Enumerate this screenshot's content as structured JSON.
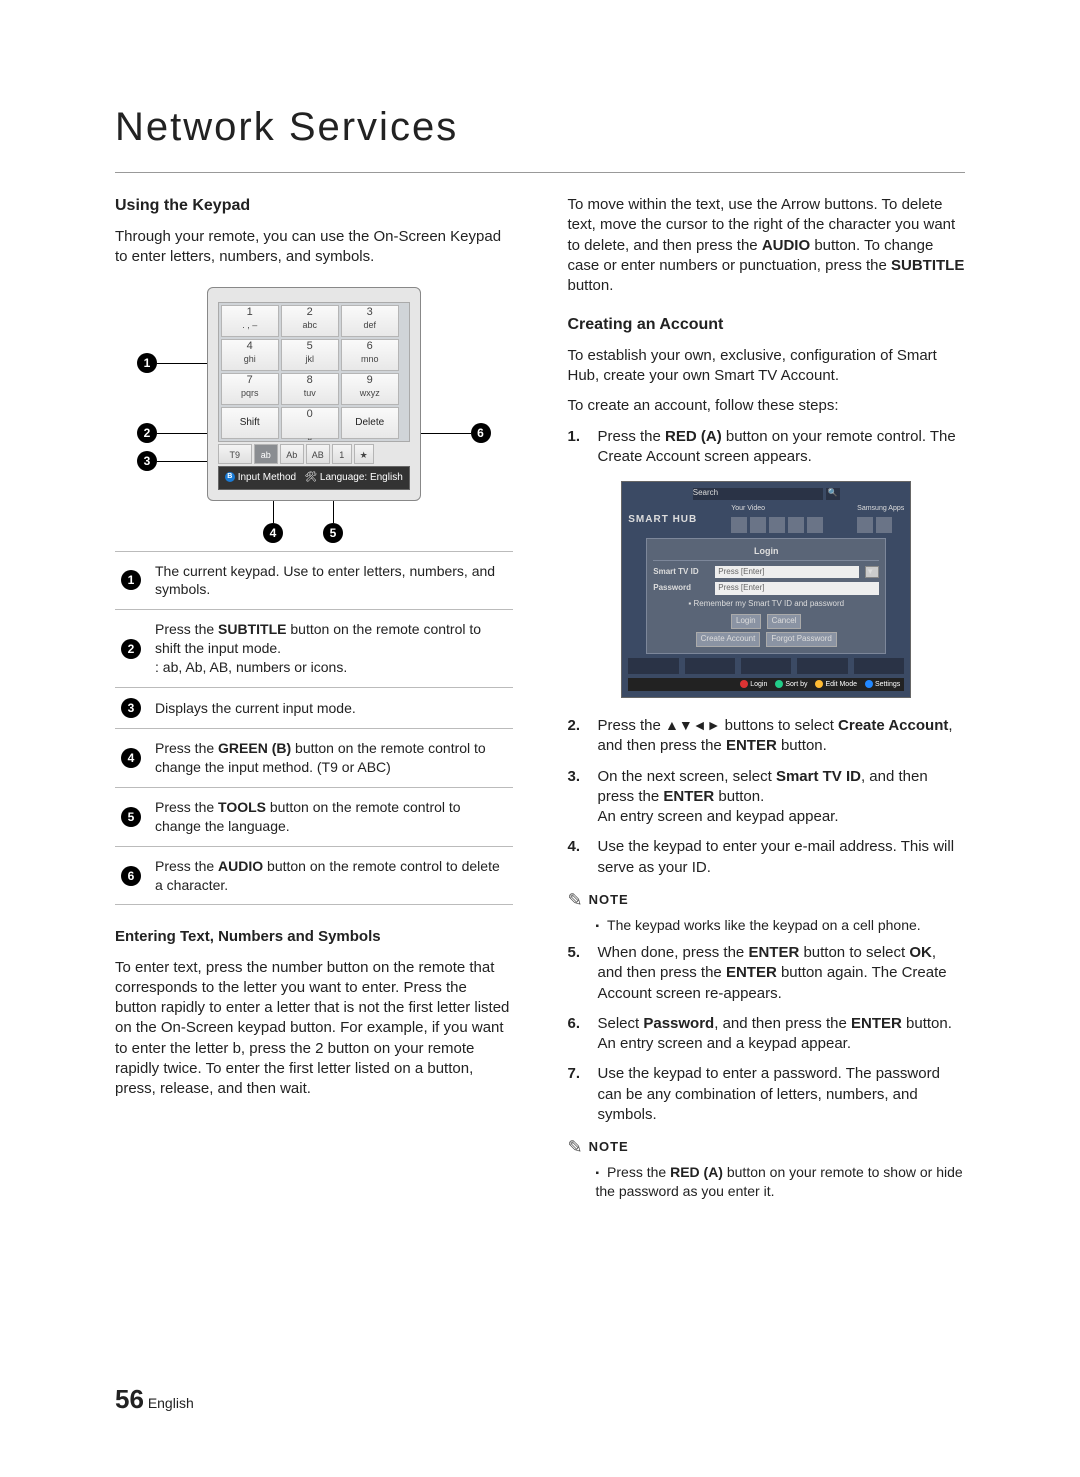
{
  "page": {
    "title": "Network Services",
    "number": "56",
    "language_label": "English"
  },
  "left": {
    "heading1": "Using the Keypad",
    "intro": "Through your remote, you can use the On-Screen Keypad to enter letters, numbers, and symbols.",
    "keypad": {
      "keys": [
        {
          "num": "1",
          "let": ". , –"
        },
        {
          "num": "2",
          "let": "abc"
        },
        {
          "num": "3",
          "let": "def"
        },
        {
          "num": "4",
          "let": "ghi"
        },
        {
          "num": "5",
          "let": "jkl"
        },
        {
          "num": "6",
          "let": "mno"
        },
        {
          "num": "7",
          "let": "pqrs"
        },
        {
          "num": "8",
          "let": "tuv"
        },
        {
          "num": "9",
          "let": "wxyz"
        }
      ],
      "shift": "Shift",
      "zero": "0",
      "space": "⎵",
      "delete": "Delete",
      "mode_row": {
        "t9": "T9",
        "ab_low": "ab",
        "ab_cap": "Ab",
        "ab_up": "AB",
        "one": "1",
        "star": "★"
      },
      "footer_input": "Input Method",
      "footer_lang": "Language: English"
    },
    "legend": [
      "The current keypad.\nUse to enter letters, numbers, and symbols.",
      "Press the SUBTITLE button on the remote control to shift the input mode.\n: ab, Ab, AB, numbers or icons.",
      "Displays the current input mode.",
      "Press the GREEN (B) button on the remote control to change the input method. (T9 or ABC)",
      "Press the TOOLS button on the remote control to change the language.",
      "Press the AUDIO button on the remote control to delete a character."
    ],
    "legend_bold": {
      "1": "SUBTITLE",
      "3": "GREEN (B)",
      "4": "TOOLS",
      "5": "AUDIO"
    },
    "heading2": "Entering Text, Numbers and Symbols",
    "para2": "To enter text, press the number button on the remote that corresponds to the letter you want to enter. Press the button rapidly to enter a letter that is not the first letter listed on the On-Screen keypad button. For example, if you want to enter the letter b, press the 2 button on your remote rapidly twice. To enter the first letter listed on a button, press, release, and then wait."
  },
  "right": {
    "para_top": "To move within the text, use the Arrow buttons. To delete text, move the cursor to the right of the character you want to delete, and then press the AUDIO button. To change case or enter numbers or punctuation, press the SUBTITLE button.",
    "para_top_bold1": "AUDIO",
    "para_top_bold2": "SUBTITLE",
    "heading": "Creating an Account",
    "intro1": "To establish your own, exclusive, configuration of Smart Hub, create your own Smart TV Account.",
    "intro2": "To create an account, follow these steps:",
    "steps": {
      "1": {
        "pre": "Press the ",
        "b": "RED (A)",
        "post": " button on your remote control. The Create Account screen appears."
      },
      "2": {
        "pre": "Press the ",
        "arrows": "▲▼◄►",
        "mid": " buttons to select ",
        "b": "Create Account",
        "post": ", and then press the ",
        "b2": "ENTER",
        "post2": " button."
      },
      "3": {
        "pre": "On the next screen, select ",
        "b": "Smart TV ID",
        "mid": ", and then press the ",
        "b2": "ENTER",
        "post": " button.\nAn entry screen and keypad appear."
      },
      "4": "Use the keypad to enter your e-mail address. This will serve as your ID.",
      "5": {
        "pre": "When done, press the ",
        "b": "ENTER",
        "mid": " button to select ",
        "b2": "OK",
        "mid2": ", and then press the ",
        "b3": "ENTER",
        "post": " button again. The Create Account screen re-appears."
      },
      "6": {
        "pre": "Select ",
        "b": "Password",
        "mid": ", and then press the ",
        "b2": "ENTER",
        "post": " button. An entry screen and a keypad appear."
      },
      "7": "Use the keypad to enter a password. The password can be any combination of letters, numbers, and symbols."
    },
    "note_label": "NOTE",
    "note1": "The keypad works like the keypad on a cell phone.",
    "note2_pre": "Press the ",
    "note2_b": "RED (A)",
    "note2_post": " button on your remote to show or hide the password as you enter it.",
    "hub": {
      "brand": "SMART HUB",
      "search": "Search",
      "your_video": "Your Video",
      "samsung_apps": "Samsung Apps",
      "login_title": "Login",
      "id_label": "Smart TV ID",
      "pw_label": "Password",
      "press_enter": "Press [Enter]",
      "remember": "Remember my Smart TV ID and password",
      "login_btn": "Login",
      "cancel_btn": "Cancel",
      "create_btn": "Create Account",
      "forgot_btn": "Forgot Password",
      "footer": {
        "a": "Login",
        "b": "Sort by",
        "c": "Edit Mode",
        "d": "Settings"
      }
    }
  }
}
